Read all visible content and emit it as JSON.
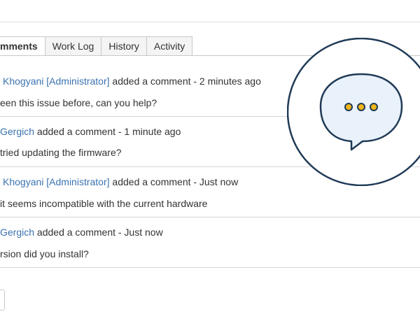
{
  "tabs": [
    {
      "label": "mments",
      "active": true
    },
    {
      "label": "Work Log",
      "active": false
    },
    {
      "label": "History",
      "active": false
    },
    {
      "label": "Activity",
      "active": false
    }
  ],
  "comments": [
    {
      "author": "Khogyani [Administrator]",
      "action": " added a comment - 2 minutes ago",
      "text": "een this issue before, can you help?"
    },
    {
      "author": "Gergich",
      "action": " added a comment - 1 minute ago",
      "text": "tried updating the firmware?"
    },
    {
      "author": "Khogyani [Administrator]",
      "action": " added a comment - Just now",
      "text": "it seems incompatible with the current hardware"
    },
    {
      "author": "Gergich",
      "action": " added a comment - Just now",
      "text": "rsion did you install?"
    }
  ],
  "colors": {
    "link": "#3b73af",
    "bubble_outline": "#1f3a56",
    "bubble_fill": "#e9f1fa",
    "dots": "#f2b51b"
  },
  "icons": {
    "chat": "chat-bubble-icon"
  }
}
